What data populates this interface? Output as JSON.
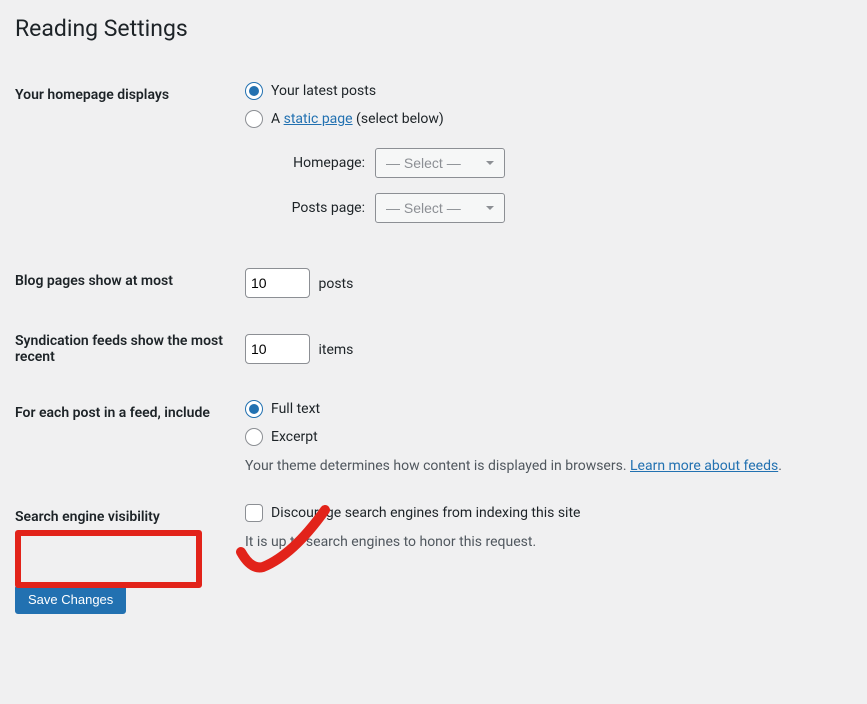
{
  "page_title": "Reading Settings",
  "homepage": {
    "label": "Your homepage displays",
    "options": {
      "latest_posts": "Your latest posts",
      "static_prefix": "A ",
      "static_link": "static page",
      "static_suffix": " (select below)"
    },
    "sub_selects": {
      "homepage_label": "Homepage:",
      "posts_page_label": "Posts page:",
      "select_placeholder": "— Select —"
    }
  },
  "blog_pages": {
    "label": "Blog pages show at most",
    "value": "10",
    "suffix": "posts"
  },
  "syndication": {
    "label": "Syndication feeds show the most recent",
    "value": "10",
    "suffix": "items"
  },
  "feed_post": {
    "label": "For each post in a feed, include",
    "options": {
      "full_text": "Full text",
      "excerpt": "Excerpt"
    },
    "description_prefix": "Your theme determines how content is displayed in browsers. ",
    "learn_more": "Learn more about feeds",
    "description_suffix": "."
  },
  "search_engine": {
    "label": "Search engine visibility",
    "checkbox_label": "Discourage search engines from indexing this site",
    "description": "It is up to search engines to honor this request."
  },
  "save_button": "Save Changes"
}
